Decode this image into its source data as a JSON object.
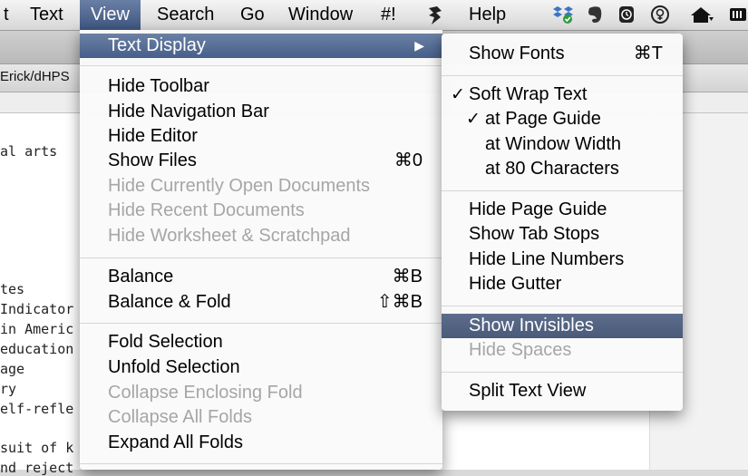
{
  "menubar": {
    "items": [
      "t",
      "Text",
      "View",
      "Search",
      "Go",
      "Window",
      "#!",
      "Help"
    ],
    "active": "View"
  },
  "editor": {
    "path": "Erick/dHPS",
    "lines": [
      "al arts",
      "tes",
      "Indicator",
      "in Americ",
      "education",
      "age",
      "ry",
      "elf-refle",
      "suit of k",
      "nd reject"
    ]
  },
  "view_menu": {
    "text_display": "Text Display",
    "hide_toolbar": "Hide Toolbar",
    "hide_navigation_bar": "Hide Navigation Bar",
    "hide_editor": "Hide Editor",
    "show_files": "Show Files",
    "show_files_shortcut": "⌘0",
    "hide_open_docs": "Hide Currently Open Documents",
    "hide_recent_docs": "Hide Recent Documents",
    "hide_worksheet": "Hide Worksheet & Scratchpad",
    "balance": "Balance",
    "balance_shortcut": "⌘B",
    "balance_fold": "Balance & Fold",
    "balance_fold_shortcut": "⇧⌘B",
    "fold_selection": "Fold Selection",
    "unfold_selection": "Unfold Selection",
    "collapse_enclosing": "Collapse Enclosing Fold",
    "collapse_all": "Collapse All Folds",
    "expand_all": "Expand All Folds"
  },
  "submenu": {
    "show_fonts": "Show Fonts",
    "show_fonts_shortcut": "⌘T",
    "soft_wrap": "Soft Wrap Text",
    "at_page_guide": "at Page Guide",
    "at_window_width": "at Window Width",
    "at_80_chars": "at 80 Characters",
    "hide_page_guide": "Hide Page Guide",
    "show_tab_stops": "Show Tab Stops",
    "hide_line_numbers": "Hide Line Numbers",
    "hide_gutter": "Hide Gutter",
    "show_invisibles": "Show Invisibles",
    "hide_spaces": "Hide Spaces",
    "split_text_view": "Split Text View",
    "checkmark": "✓"
  },
  "icons": {
    "submenu_arrow": "▶"
  },
  "colors": {
    "highlight": "#465f89",
    "disabled_text": "#a6a6a6"
  }
}
